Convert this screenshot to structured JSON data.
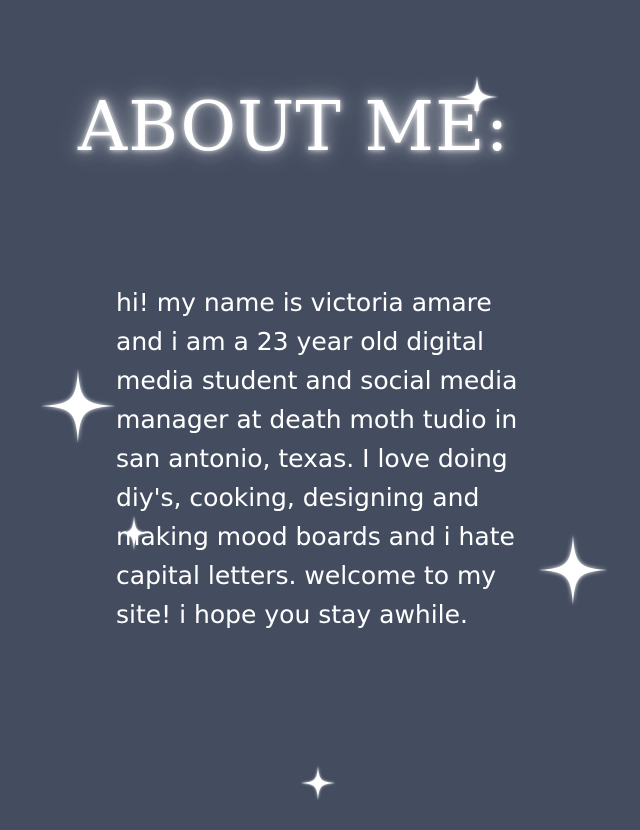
{
  "heading": "ABOUT ME:",
  "bio": "hi! my name is victoria amare and i am a 23 year old digital media student and social media manager at death moth tudio in san antonio, texas. I love doing diy's, cooking, designing and making mood boards and i hate capital letters. welcome to my site! i hope you stay awhile.",
  "colors": {
    "background": "#444d60",
    "text": "#ffffff"
  },
  "decorations": [
    "sparkle-icon",
    "sparkle-icon",
    "sparkle-icon",
    "sparkle-icon",
    "sparkle-icon"
  ]
}
